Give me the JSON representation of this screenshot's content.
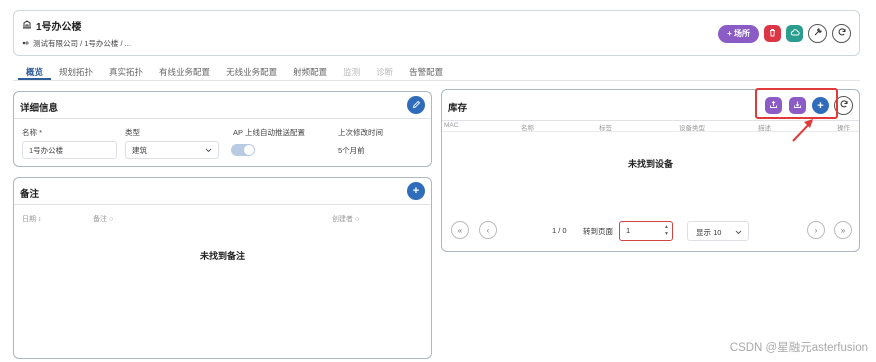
{
  "header": {
    "title": "1号办公楼",
    "breadcrumb": "测试有限公司 / 1号办公楼 / ...",
    "place_button": "+ 场所"
  },
  "tabs": [
    {
      "label": "概览",
      "state": "active"
    },
    {
      "label": "规划拓扑",
      "state": "normal"
    },
    {
      "label": "真实拓扑",
      "state": "normal"
    },
    {
      "label": "有线业务配置",
      "state": "normal"
    },
    {
      "label": "无线业务配置",
      "state": "normal"
    },
    {
      "label": "射频配置",
      "state": "normal"
    },
    {
      "label": "监测",
      "state": "disabled"
    },
    {
      "label": "诊断",
      "state": "disabled"
    },
    {
      "label": "告警配置",
      "state": "normal"
    }
  ],
  "details": {
    "title": "详细信息",
    "name_label": "名称 *",
    "name_value": "1号办公楼",
    "type_label": "类型",
    "type_value": "建筑",
    "ap_label": "AP 上线自动推送配置",
    "ap_enabled": true,
    "modified_label": "上次修改时间",
    "modified_value": "5个月前"
  },
  "notes": {
    "title": "备注",
    "columns": [
      "日期 ↕",
      "备注 ○",
      "创建者 ○"
    ],
    "empty": "未找到备注"
  },
  "inventory": {
    "title": "库存",
    "columns": [
      "MAC",
      "名称",
      "标签",
      "设备类型",
      "描述",
      "操作"
    ],
    "empty": "未找到设备",
    "page_info": "1 / 0",
    "goto_label": "转到页面",
    "goto_value": "1",
    "show_label": "显示 10"
  },
  "icons": {
    "building": "building-icon",
    "place_plus": "plus-icon",
    "delete": "trash-icon",
    "cloud": "cloud-icon",
    "wrench": "wrench-icon",
    "refresh": "refresh-icon",
    "edit": "pencil-icon",
    "upload": "upload-icon",
    "download": "download-icon"
  },
  "colors": {
    "primary": "#2f6dbb",
    "purple": "#8b5cc6",
    "danger": "#dc3545",
    "teal": "#2a9d8f",
    "annotation": "#e03a3a"
  },
  "watermark": "CSDN @星融元asterfusion"
}
